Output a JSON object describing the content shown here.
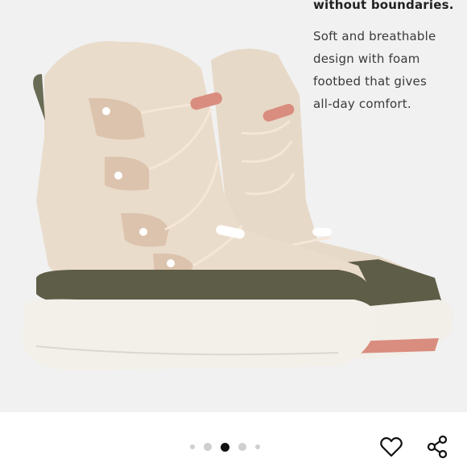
{
  "product": {
    "headline": "without boundaries.",
    "description": "Soft and breathable\ndesign with foam\nfootbed that gives\nall-day comfort."
  },
  "image": {
    "subject": "boots-image",
    "colors": {
      "background": "#f1f1f1",
      "shearling": "#eadccb",
      "suede": "#e6cdb8",
      "rubber": "#5e5d47",
      "sole": "#f3f0ea",
      "toggle": "#d98d7f"
    }
  },
  "carousel": {
    "total": 5,
    "active_index": 2
  },
  "actions": {
    "favorite_icon": "heart-icon",
    "share_icon": "share-icon"
  }
}
